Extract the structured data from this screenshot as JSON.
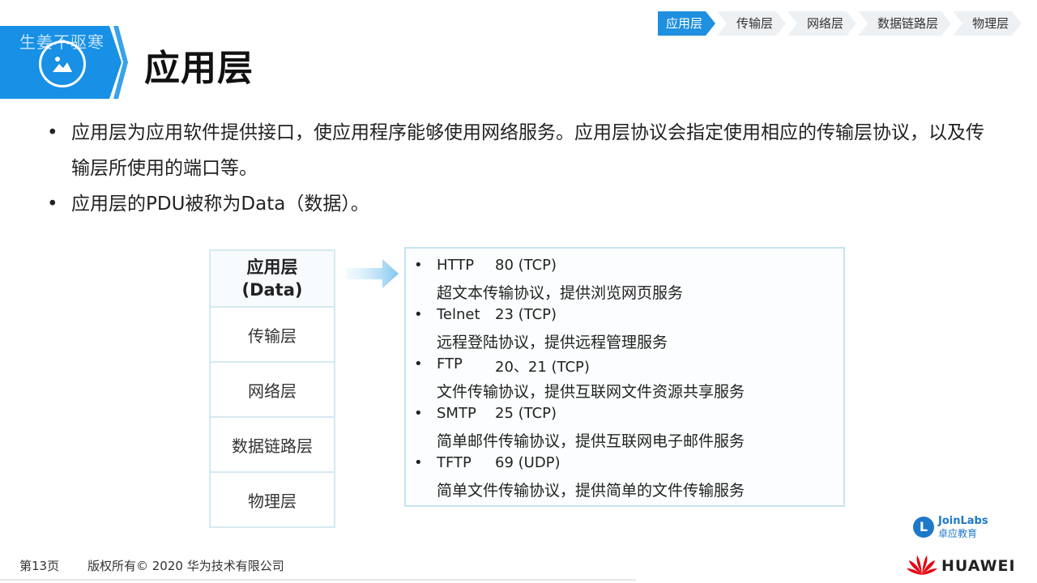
{
  "breadcrumb": {
    "items": [
      "应用层",
      "传输层",
      "网络层",
      "数据链路层",
      "物理层"
    ],
    "active_index": 0
  },
  "banner": {
    "watermark": "生姜不驱寒"
  },
  "page_title": "应用层",
  "bullets": [
    "应用层为应用软件提供接口，使应用程序能够使用网络服务。应用层协议会指定使用相应的传输层协议，以及传输层所使用的端口等。",
    "应用层的PDU被称为Data（数据）。"
  ],
  "layer_stack": {
    "top_name": "应用层",
    "top_pdu": "(Data)",
    "layers": [
      "传输层",
      "网络层",
      "数据链路层",
      "物理层"
    ]
  },
  "protocols": [
    {
      "name": "HTTP",
      "port": "80 (TCP)",
      "desc": "超文本传输协议，提供浏览网页服务"
    },
    {
      "name": "Telnet",
      "port": "23 (TCP)",
      "desc": "远程登陆协议，提供远程管理服务"
    },
    {
      "name": "FTP",
      "port": "20、21 (TCP)",
      "desc": "文件传输协议，提供互联网文件资源共享服务"
    },
    {
      "name": "SMTP",
      "port": "25 (TCP)",
      "desc": "简单邮件传输协议，提供互联网电子邮件服务"
    },
    {
      "name": "TFTP",
      "port": "69 (UDP)",
      "desc": "简单文件传输协议，提供简单的文件传输服务"
    }
  ],
  "footer": {
    "page": "第13页",
    "copyright": "版权所有© 2020 华为技术有限公司"
  },
  "brands": {
    "joinlabs_en": "JoinLabs",
    "joinlabs_cn": "卓应教育",
    "huawei": "HUAWEI"
  },
  "colors": {
    "accent": "#1790e6",
    "huawei_red": "#e60012",
    "joinlabs_blue": "#1e78c8"
  }
}
